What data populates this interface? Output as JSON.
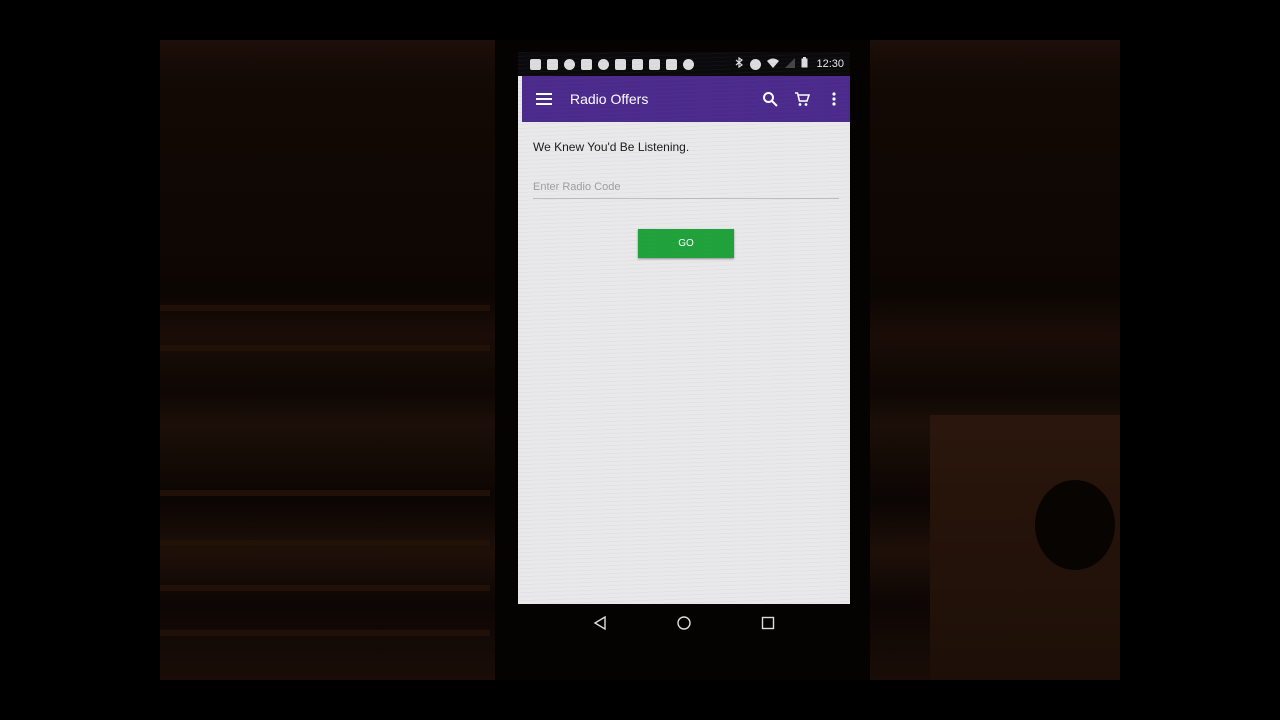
{
  "status_bar": {
    "time": "12:30",
    "notification_icons": [
      "message-icon",
      "facebook-icon",
      "alarm-icon",
      "wrench-icon",
      "smiley-icon",
      "facebook-icon",
      "facebook-icon",
      "photo-icon",
      "translate-icon",
      "smiley-icon"
    ],
    "system_icons": [
      "bluetooth-icon",
      "alarm-icon",
      "wifi-icon",
      "signal-icon",
      "battery-icon"
    ]
  },
  "app_bar": {
    "title": "Radio Offers",
    "color": "#4b2a8c",
    "actions": [
      "search-icon",
      "cart-icon",
      "more-vert-icon"
    ]
  },
  "main": {
    "headline": "We Knew You'd Be Listening.",
    "radio_code": {
      "value": "",
      "placeholder": "Enter Radio Code"
    },
    "go_label": "GO",
    "go_color": "#1fa23a"
  },
  "nav_bar": {
    "buttons": [
      "back-icon",
      "home-icon",
      "recents-icon"
    ]
  }
}
